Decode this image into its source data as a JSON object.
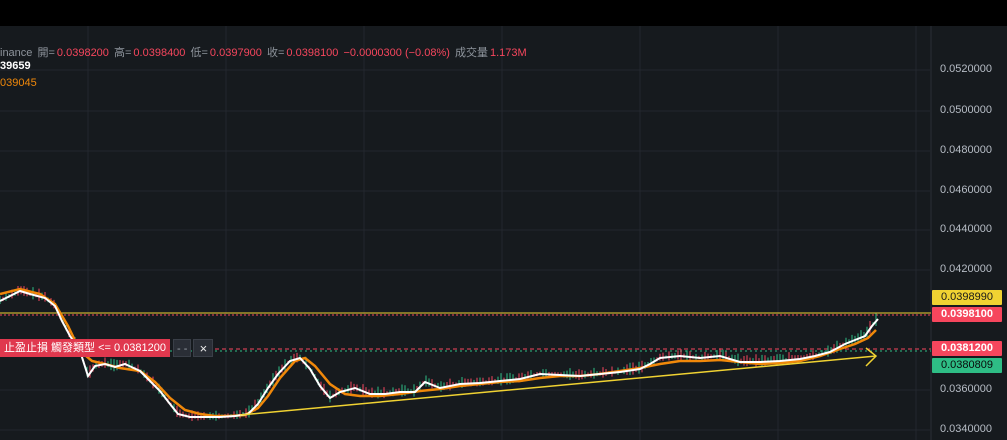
{
  "legend": {
    "source": "inance",
    "open_label": "開=",
    "open": "0.0398200",
    "high_label": "高=",
    "high": "0.0398400",
    "low_label": "低=",
    "low": "0.0397900",
    "close_label": "收=",
    "close": "0.0398100",
    "change": "−0.0000300 (−0.08%)",
    "volume_label": "成交量",
    "volume": "1.173M"
  },
  "ma": {
    "ma1": "39659",
    "ma2": "039045"
  },
  "order": {
    "label": "止盈止損 觸發類型 <= 0.0381200",
    "drag": "- -",
    "close_icon": "×"
  },
  "price_axis": {
    "ticks": [
      "0.0520000",
      "0.0500000",
      "0.0480000",
      "0.0460000",
      "0.0440000",
      "0.0420000",
      "0.0360000",
      "0.0340000"
    ],
    "tag_yellow": "0.0398990",
    "tag_current": "0.0398100",
    "tag_order": "0.0381200",
    "tag_green": "0.0380809"
  },
  "colors": {
    "background": "#161a1e",
    "grid": "#23272e",
    "up": "#2ebd85",
    "down": "#f6465d",
    "ma1": "#ffffff",
    "ma2": "#f0880a",
    "trendline": "#f0d232"
  }
}
